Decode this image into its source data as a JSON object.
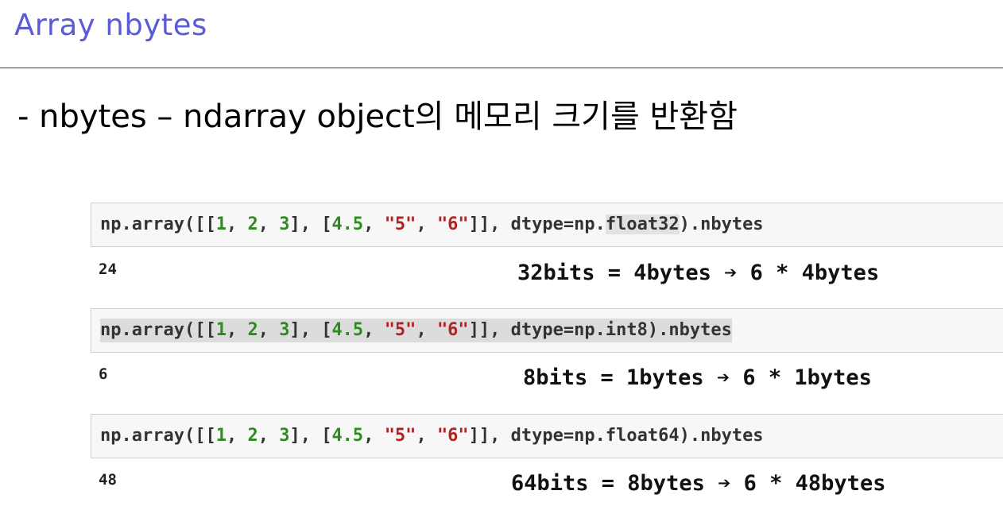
{
  "title": "Array nbytes",
  "subtitle": "- nbytes – ndarray object의 메모리 크기를 반환함",
  "examples": [
    {
      "code": {
        "prefix": "np.array([[",
        "n1": "1",
        "s1": ", ",
        "n2": "2",
        "s2": ", ",
        "n3": "3",
        "mid": "], [",
        "n4": "4.5",
        "s3": ", ",
        "str1": "\"5\"",
        "s4": ", ",
        "str2": "\"6\"",
        "end": "]], dtype=np.",
        "dtype": "float32",
        "tail": ").nbytes"
      },
      "output": "24",
      "note": "32bits = 4bytes",
      "note2": "6 * 4bytes"
    },
    {
      "code": {
        "prefix": "np.array([[",
        "n1": "1",
        "s1": ", ",
        "n2": "2",
        "s2": ", ",
        "n3": "3",
        "mid": "], [",
        "n4": "4.5",
        "s3": ", ",
        "str1": "\"5\"",
        "s4": ", ",
        "str2": "\"6\"",
        "end": "]], dtype=np.",
        "dtype": "int8",
        "tail": ").nbytes"
      },
      "output": "6",
      "note": "8bits = 1bytes",
      "note2": "6 * 1bytes"
    },
    {
      "code": {
        "prefix": "np.array([[",
        "n1": "1",
        "s1": ", ",
        "n2": "2",
        "s2": ", ",
        "n3": "3",
        "mid": "], [",
        "n4": "4.5",
        "s3": ", ",
        "str1": "\"5\"",
        "s4": ", ",
        "str2": "\"6\"",
        "end": "]], dtype=np.",
        "dtype": "float64",
        "tail": ").nbytes"
      },
      "output": "48",
      "note": "64bits = 8bytes",
      "note2": "6 * 48bytes"
    }
  ],
  "arrow_icon": "right-arrow-icon",
  "colors": {
    "title": "#5b5bd6",
    "number": "#2e8b20",
    "string": "#b22222",
    "cell_bg": "#f7f7f7"
  }
}
